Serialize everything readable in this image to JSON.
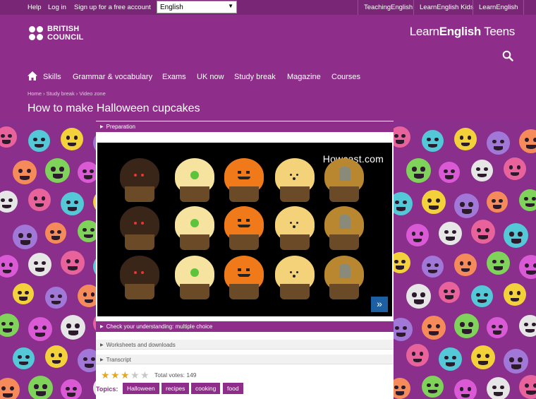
{
  "topbar": {
    "help": "Help",
    "login": "Log in",
    "signup": "Sign up for a free account",
    "language_value": "English",
    "right_links": [
      "TeachingEnglish",
      "LearnEnglish Kids",
      "LearnEnglish"
    ]
  },
  "brand": {
    "bc_line1": "BRITISH",
    "bc_line2": "COUNCIL",
    "le_light": "Learn",
    "le_bold": "English",
    "le_suffix": " Teens"
  },
  "nav": [
    "Skills",
    "Grammar & vocabulary",
    "Exams",
    "UK now",
    "Study break",
    "Magazine",
    "Courses"
  ],
  "breadcrumb": "Home › Study break › Video zone",
  "page_title": "How to make Halloween cupcakes",
  "sections": {
    "preparation": "Preparation",
    "check": "Check your understanding: multiple choice",
    "worksheets": "Worksheets and downloads",
    "transcript": "Transcript"
  },
  "video": {
    "brand": "Howcast.com",
    "expand_icon": "expand-icon"
  },
  "rating": {
    "stars_filled": 3,
    "stars_total": 5,
    "votes_text": "Total votes: 149"
  },
  "topics": {
    "label": "Topics:",
    "tags": [
      "Halloween",
      "recipes",
      "cooking",
      "food"
    ]
  },
  "colors": {
    "brand_purple": "#8e2e8a",
    "star_gold": "#e5a823"
  }
}
